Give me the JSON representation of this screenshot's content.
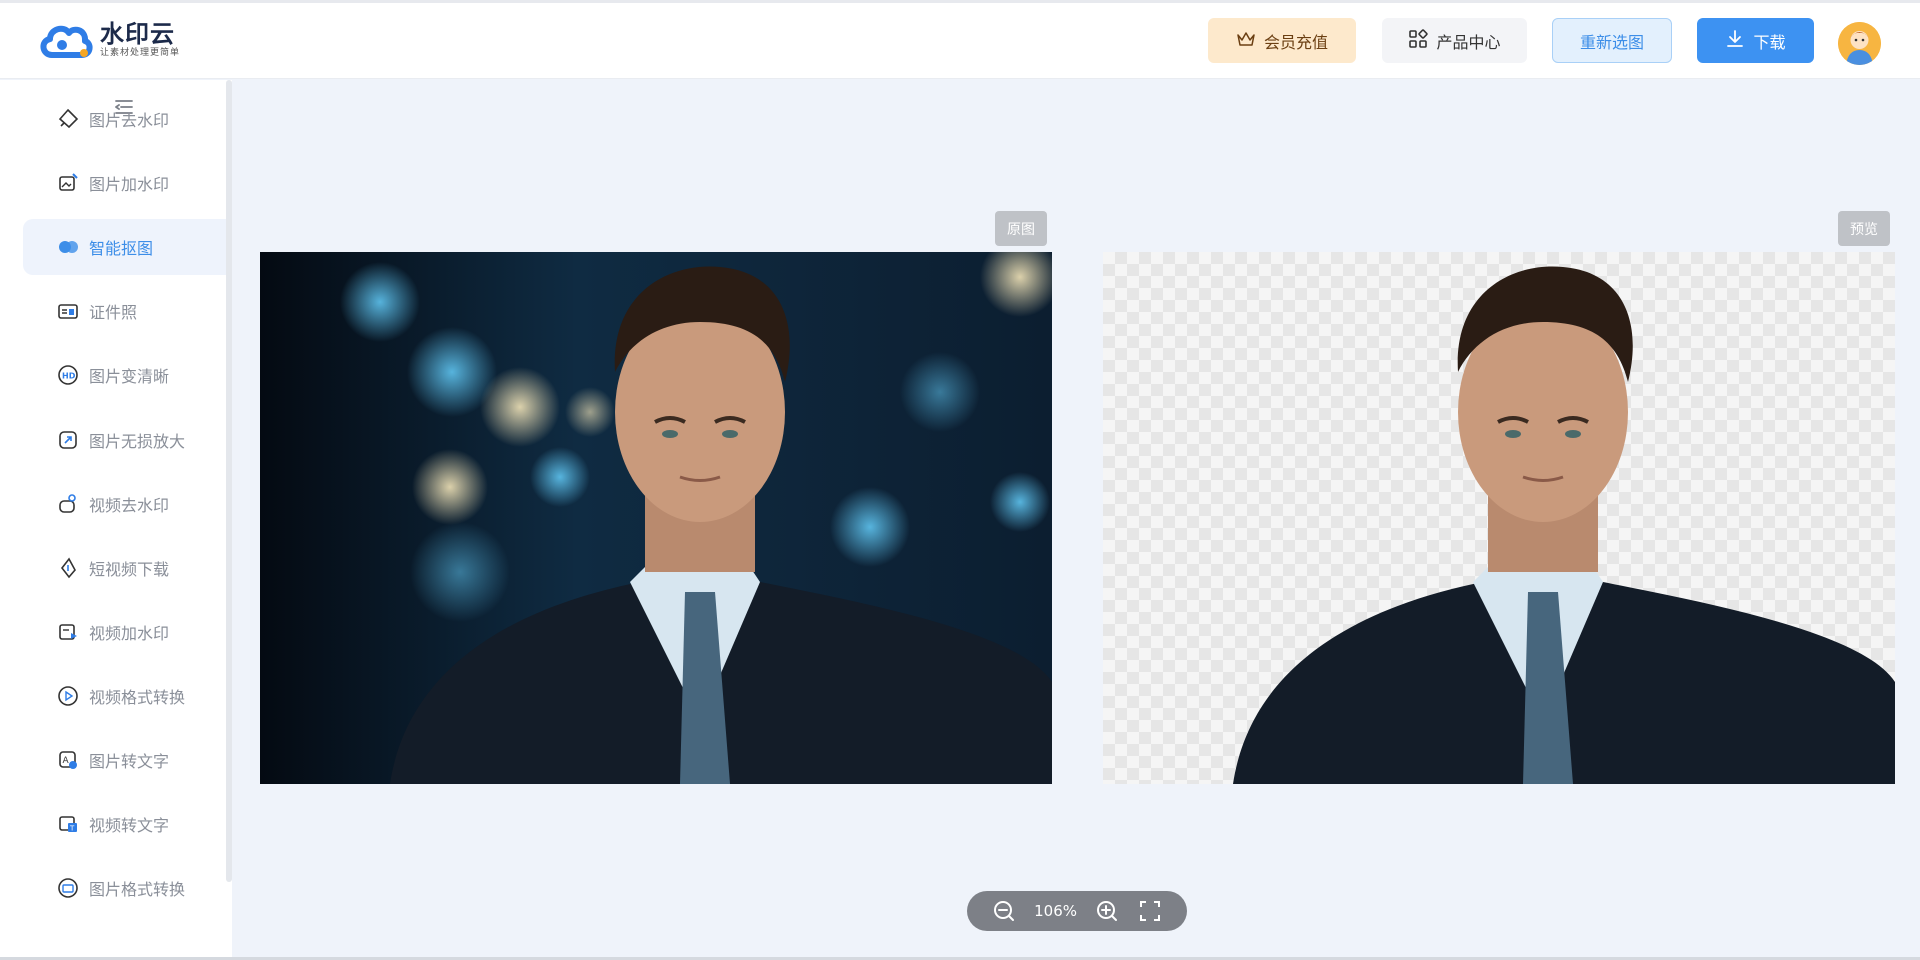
{
  "brand": {
    "name": "水印云",
    "slogan": "让素材处理更简单",
    "color": "#2f7de6"
  },
  "header": {
    "vip_label": "会员充值",
    "products_label": "产品中心",
    "reselect_label": "重新选图",
    "download_label": "下载",
    "icons": {
      "vip": "crown-icon",
      "products": "grid-icon",
      "download": "download-icon"
    }
  },
  "sidebar": {
    "items": [
      {
        "label": "图片去水印",
        "icon": "eraser-icon",
        "active": false
      },
      {
        "label": "图片加水印",
        "icon": "image-edit-icon",
        "active": false
      },
      {
        "label": "智能抠图",
        "icon": "cutout-icon",
        "active": true
      },
      {
        "label": "证件照",
        "icon": "id-card-icon",
        "active": false
      },
      {
        "label": "图片变清晰",
        "icon": "hd-icon",
        "active": false
      },
      {
        "label": "图片无损放大",
        "icon": "enlarge-icon",
        "active": false
      },
      {
        "label": "视频去水印",
        "icon": "video-erase-icon",
        "active": false
      },
      {
        "label": "短视频下载",
        "icon": "short-video-download-icon",
        "active": false
      },
      {
        "label": "视频加水印",
        "icon": "video-watermark-icon",
        "active": false
      },
      {
        "label": "视频格式转换",
        "icon": "video-convert-icon",
        "active": false
      },
      {
        "label": "图片转文字",
        "icon": "image-to-text-icon",
        "active": false
      },
      {
        "label": "视频转文字",
        "icon": "video-to-text-icon",
        "active": false
      },
      {
        "label": "图片格式转换",
        "icon": "image-format-icon",
        "active": false
      }
    ]
  },
  "workspace": {
    "original_label": "原图",
    "preview_label": "预览"
  },
  "zoom": {
    "level": "106%"
  },
  "colors": {
    "accent": "#3d8ee8",
    "vip_bg": "#fde9cc",
    "page_bg": "#eff3fa"
  }
}
